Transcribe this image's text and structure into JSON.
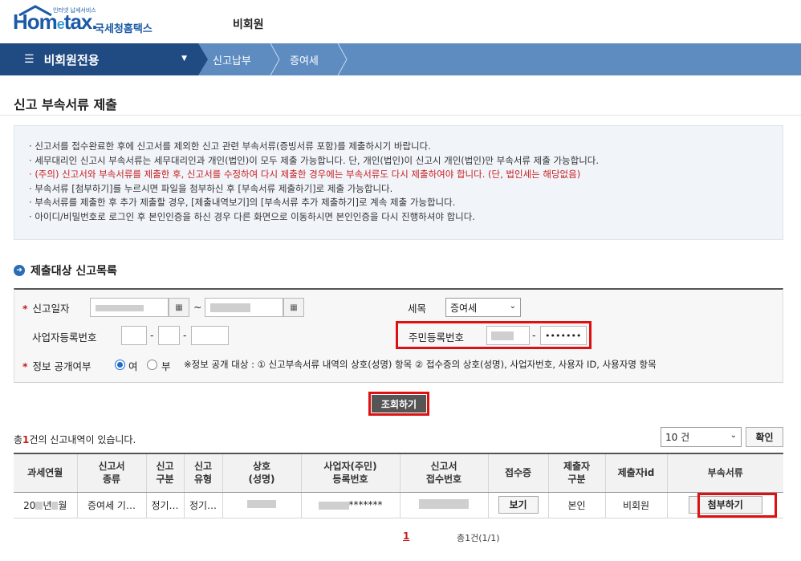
{
  "header": {
    "logo_small": "인터넷 납세서비스",
    "logo_brand_a": "Hom",
    "logo_brand_e": "e",
    "logo_brand_b": "tax.",
    "logo_kr": "국세청홈택스",
    "member_label": "비회원"
  },
  "nav": {
    "menu_label": "비회원전용",
    "breadcrumbs": [
      "신고납부",
      "증여세"
    ]
  },
  "page_title": "신고 부속서류 제출",
  "notice": [
    {
      "text": "신고서를 접수완료한 후에 신고서를 제외한 신고 관련 부속서류(증빙서류 포함)를 제출하시기 바랍니다.",
      "red": false
    },
    {
      "text": "세무대리인 신고시 부속서류는 세무대리인과 개인(법인)이 모두 제출 가능합니다. 단, 개인(법인)이 신고시 개인(법인)만 부속서류 제출 가능합니다.",
      "red": false
    },
    {
      "text": "(주의) 신고서와 부속서류를 제출한 후, 신고서를 수정하여 다시 제출한 경우에는 부속서류도 다시 제출하여야 합니다. (단, 법인세는 해당없음)",
      "red": true
    },
    {
      "text": "부속서류 [첨부하기]를 누르시면 파일을 첨부하신 후 [부속서류 제출하기]로 제출 가능합니다.",
      "red": false
    },
    {
      "text": "부속서류를 제출한 후 추가 제출할 경우, [제출내역보기]의 [부속서류 추가 제출하기]로 계속 제출 가능합니다.",
      "red": false
    },
    {
      "text": "아이디/비밀번호로 로그인 후 본인인증을 하신 경우 다른 화면으로 이동하시면 본인인증을 다시 진행하셔야 합니다.",
      "red": false
    }
  ],
  "section_title": "제출대상 신고목록",
  "form": {
    "date_label": "신고일자",
    "tilde": "~",
    "tax_label": "세목",
    "tax_value": "증여세",
    "bizno_label": "사업자등록번호",
    "dash": "-",
    "rrn_label": "주민등록번호",
    "rrn_masked": "•••••••",
    "disclosure_label": "정보 공개여부",
    "radio_yes": "여",
    "radio_no": "부",
    "disclosure_note": "※정보 공개 대상 : ① 신고부속서류 내역의 상호(성명) 항목 ② 접수증의 상호(성명), 사업자번호, 사용자 ID, 사용자명 항목"
  },
  "query_button": "조회하기",
  "result": {
    "count_prefix": "총",
    "count_value": "1",
    "count_suffix": "건의 신고내역이 있습니다.",
    "page_size": "10 건",
    "ok_button": "확인"
  },
  "table": {
    "headers": [
      "과세연월",
      "신고서\n종류",
      "신고\n구분",
      "신고\n유형",
      "상호\n(성명)",
      "사업자(주민)\n등록번호",
      "신고서\n접수번호",
      "접수증",
      "제출자\n구분",
      "제출자id",
      "부속서류"
    ],
    "row": {
      "year_a": "20",
      "year_b": "년",
      "year_c": "월",
      "form_type": "증여세 기…",
      "report_div": "정기…",
      "report_type": "정기…",
      "rrn_tail": "*******",
      "view_button": "보기",
      "submitter_div": "본인",
      "submitter_id": "비회원",
      "attach_button": "첨부하기"
    }
  },
  "pagination": {
    "current": "1",
    "info": "총1건(1/1)"
  },
  "colors": {
    "nav_dark": "#1f4a82",
    "nav_light": "#5e8cc1",
    "highlight_red": "#dd1111",
    "brand_blue": "#1b5aa7"
  }
}
